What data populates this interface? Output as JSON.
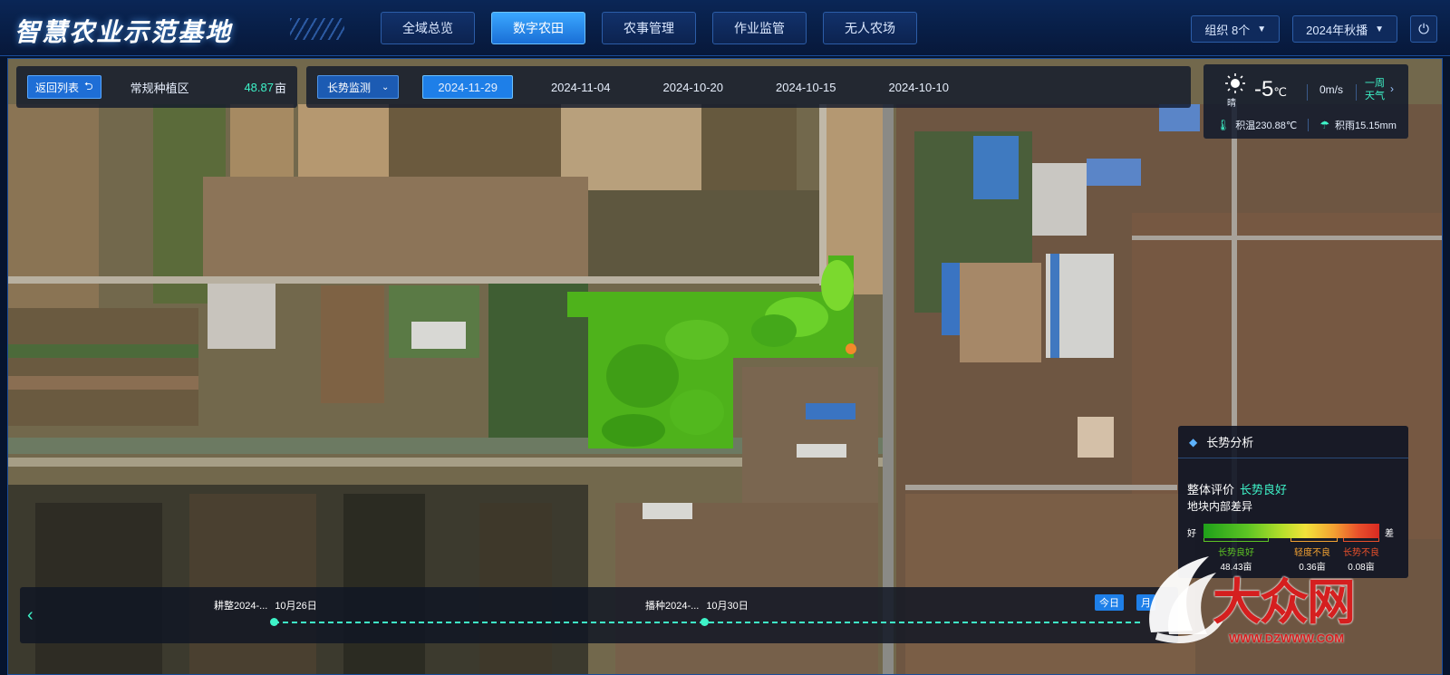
{
  "header": {
    "title": "智慧农业示范基地",
    "tabs": [
      {
        "label": "全域总览",
        "active": false
      },
      {
        "label": "数字农田",
        "active": true
      },
      {
        "label": "农事管理",
        "active": false
      },
      {
        "label": "作业监管",
        "active": false
      },
      {
        "label": "无人农场",
        "active": false
      }
    ],
    "org_selector": "组织 8个",
    "season_selector": "2024年秋播"
  },
  "toolbar": {
    "back_label": "返回列表",
    "area_name": "常规种植区",
    "area_value": "48.87",
    "area_unit": "亩",
    "mode_label": "长势监测",
    "dates": [
      {
        "label": "2024-11-29",
        "active": true
      },
      {
        "label": "2024-11-04",
        "active": false
      },
      {
        "label": "2024-10-20",
        "active": false
      },
      {
        "label": "2024-10-15",
        "active": false
      },
      {
        "label": "2024-10-10",
        "active": false
      }
    ]
  },
  "weather": {
    "condition": "晴",
    "temperature": "-5",
    "temperature_unit": "℃",
    "wind": "0m/s",
    "week_forecast_line1": "一周",
    "week_forecast_line2": "天气",
    "accumulated_temp": "积温230.88℃",
    "accumulated_rain": "积雨15.15mm"
  },
  "analysis": {
    "title": "长势分析",
    "overall_label": "整体评价",
    "overall_value": "长势良好",
    "variance_label": "地块内部差异",
    "scale_good": "好",
    "scale_bad": "差",
    "categories": [
      {
        "label": "长势良好",
        "value": "48.43亩",
        "color": "#5dc424"
      },
      {
        "label": "轻度不良",
        "value": "0.36亩",
        "color": "#f3a232"
      },
      {
        "label": "长势不良",
        "value": "0.08亩",
        "color": "#e9502b"
      }
    ]
  },
  "timeline": {
    "events": [
      {
        "label": "耕整2024-...",
        "date": "10月26日"
      },
      {
        "label": "播种2024-...",
        "date": "10月30日"
      }
    ],
    "today_label": "今日",
    "month_label": "月"
  },
  "watermark": {
    "text": "大众网",
    "url": "WWW.DZWWW.COM"
  },
  "colors": {
    "accent": "#1e7fe8",
    "highlight": "#3ef3c8",
    "header_bg": "#0a2656",
    "watermark": "#d51f1f"
  }
}
